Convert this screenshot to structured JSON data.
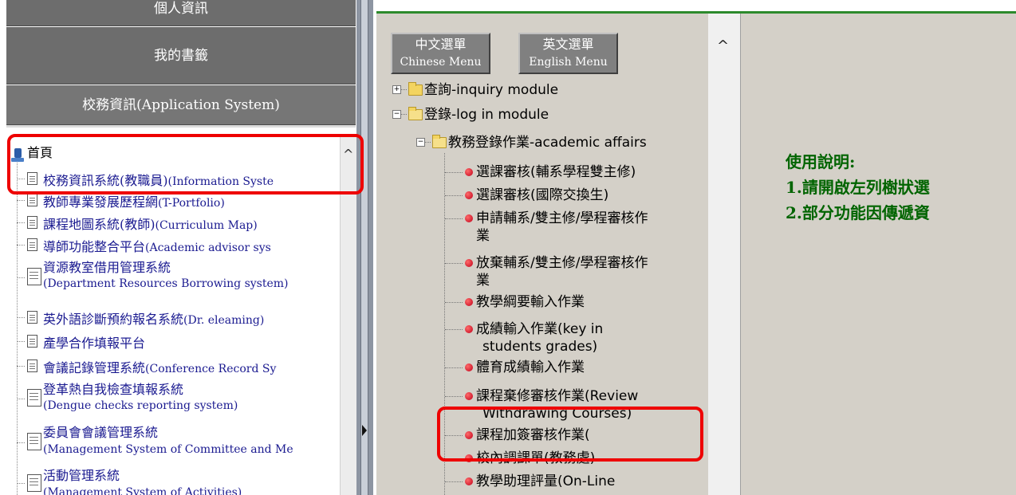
{
  "left_menu": {
    "personal_info": "個人資訊",
    "bookmarks": "我的書籤",
    "app_system": "校務資訊(Application System)"
  },
  "left_tree": {
    "root": "首頁",
    "items": [
      {
        "zh": "校務資訊系統(教職員)",
        "en": "(Information Syste"
      },
      {
        "zh": "教師專業發展歷程網",
        "en": "(T-Portfolio)"
      },
      {
        "zh": "課程地圖系統(教師)",
        "en": "(Curriculum Map)"
      },
      {
        "zh": "導師功能整合平台",
        "en": "(Academic advisor sys"
      },
      {
        "zh": "資源教室借用管理系統",
        "en": "(Department Resources Borrowing system)"
      },
      {
        "zh": "英外語診斷預約報名系統",
        "en": "(Dr. eleaming)"
      },
      {
        "zh": "產學合作填報平台",
        "en": ""
      },
      {
        "zh": "會議記錄管理系統",
        "en": "(Conference Record Sy"
      },
      {
        "zh": "登革熱自我檢查填報系統",
        "en": "(Dengue checks reporting system)"
      },
      {
        "zh": "委員會會議管理系統",
        "en": "(Management System of Committee and Me"
      },
      {
        "zh": "活動管理系統",
        "en": "(Management System of Activities)"
      }
    ]
  },
  "lang_buttons": {
    "chinese": {
      "zh": "中文選單",
      "en": "Chinese Menu"
    },
    "english": {
      "zh": "英文選單",
      "en": "English Menu"
    }
  },
  "mid_tree": {
    "inquiry": "查詢-inquiry module",
    "login": "登錄-log in module",
    "academic": "教務登錄作業-academic affairs",
    "items": [
      [
        "選課審核(輔系學程雙主修)"
      ],
      [
        "選課審核(國際交換生)"
      ],
      [
        "申請輔系/雙主修/學程審核作",
        "業"
      ],
      [
        "放棄輔系/雙主修/學程審核作",
        "業"
      ],
      [
        "教學綱要輸入作業"
      ],
      [
        "成績輸入作業(key in",
        "students grades)"
      ],
      [
        "體育成績輸入作業"
      ],
      [
        "課程棄修審核作業(Review",
        "Withdrawing Courses)"
      ],
      [
        "課程加簽審核作業("
      ],
      [
        "校內調課單(教務處)"
      ],
      [
        "教學助理評量(On-Line"
      ]
    ]
  },
  "instructions": {
    "title": "使用說明:",
    "line1": "1.請開啟左列樹狀選",
    "line2": "2.部分功能因傳遞資"
  },
  "colors": {
    "highlight": "#ee0000",
    "instructions_text": "#006400",
    "left_link": "#1a1a90",
    "menu_bg": "#6d6d6d",
    "panel_bg": "#d4d0c8"
  }
}
